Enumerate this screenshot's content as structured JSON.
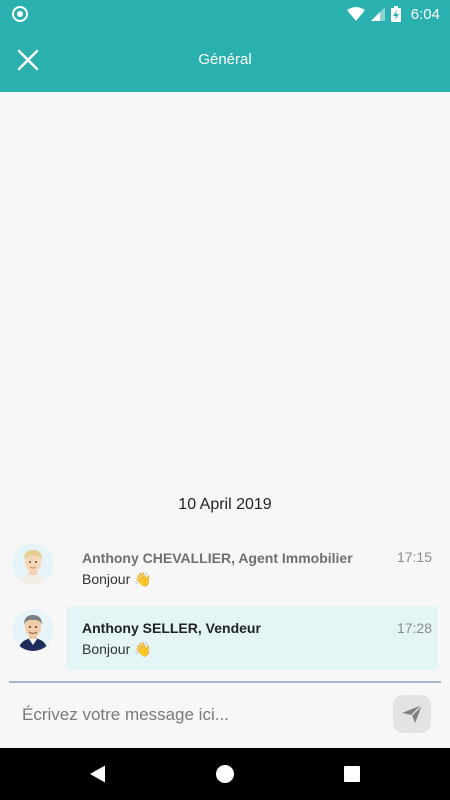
{
  "status_bar": {
    "time": "6:04",
    "icons": [
      "status-dot-icon",
      "wifi-icon",
      "signal-icon",
      "battery-charging-icon"
    ]
  },
  "header": {
    "title": "Général",
    "close_icon": "close-icon"
  },
  "conversation": {
    "date_separator": "10 April 2019",
    "messages": [
      {
        "sender": "Anthony CHEVALLIER, Agent Immobilier",
        "time": "17:15",
        "text": "Bonjour 👋",
        "avatar": "agent-avatar-icon"
      },
      {
        "sender": "Anthony SELLER, Vendeur",
        "time": "17:28",
        "text": "Bonjour 👋",
        "avatar": "seller-avatar-icon",
        "highlight_color": "#e3f5f5"
      }
    ]
  },
  "composer": {
    "placeholder": "Écrivez votre message ici...",
    "value": "",
    "send_icon": "send-icon"
  },
  "nav_bar": {
    "buttons": [
      "back-icon",
      "home-icon",
      "recents-icon"
    ]
  },
  "colors": {
    "accent": "#2bb0b0",
    "bubble": "#e3f5f5",
    "background": "#f7f7f7"
  }
}
